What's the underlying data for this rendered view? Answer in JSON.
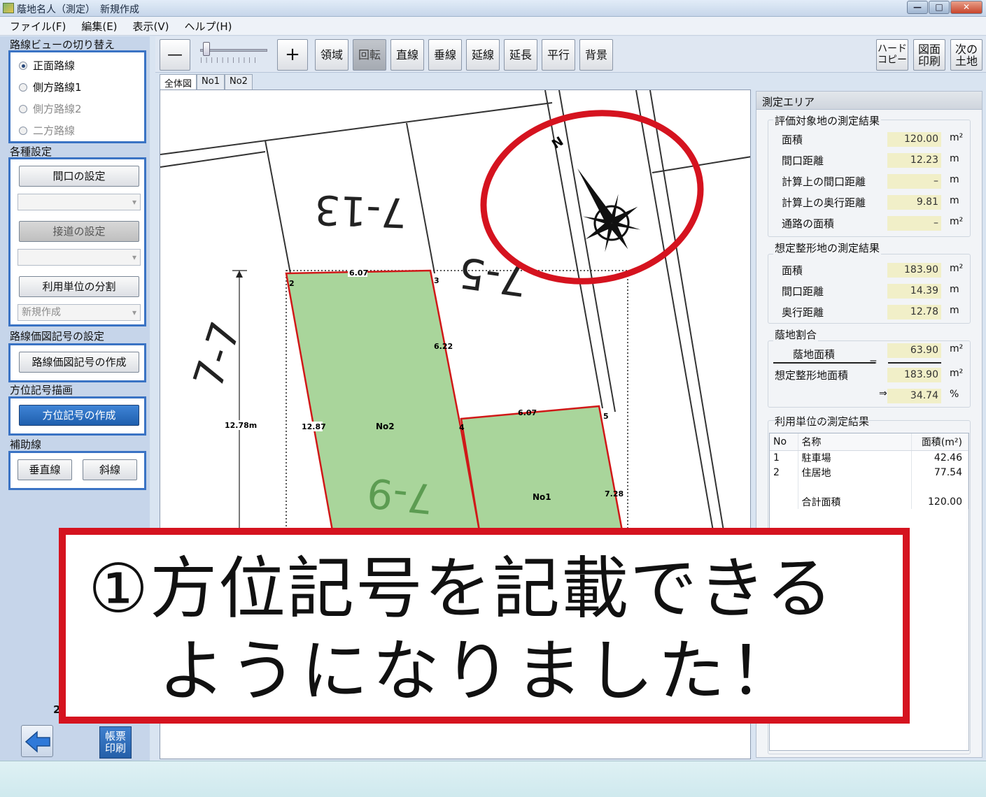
{
  "window": {
    "title": "蔭地名人（測定）　新規作成",
    "minimize": "—",
    "maximize": "□",
    "close": "✕"
  },
  "menu": [
    "ファイル(F)",
    "編集(E)",
    "表示(V)",
    "ヘルプ(H)"
  ],
  "sidebar": {
    "route_view_title": "路線ビューの切り替え",
    "route_options": [
      {
        "label": "正面路線",
        "selected": true,
        "enabled": true
      },
      {
        "label": "側方路線1",
        "selected": false,
        "enabled": true
      },
      {
        "label": "側方路線2",
        "selected": false,
        "enabled": false
      },
      {
        "label": "二方路線",
        "selected": false,
        "enabled": false
      }
    ],
    "settings_title": "各種設定",
    "frontage_button": "間口の設定",
    "road_contact_button": "接道の設定",
    "split_units_button": "利用単位の分割",
    "new_create_combo": "新規作成",
    "route_price_title": "路線価図記号の設定",
    "route_price_button": "路線価図記号の作成",
    "compass_title": "方位記号描画",
    "compass_button": "方位記号の作成",
    "aux_title": "補助線",
    "vertical_button": "垂直線",
    "diagonal_button": "斜線",
    "page_number": "2",
    "print_form_button": "帳票\n印刷"
  },
  "toolbar": {
    "zoom_out": "—",
    "zoom_in": "+",
    "zoom_level": 0.05,
    "buttons": [
      "領域",
      "回転",
      "直線",
      "垂線",
      "延線",
      "延長",
      "平行",
      "背景"
    ],
    "pressed": "回転",
    "hard_copy": "ハード\nコピー",
    "print_drawing": "図面\n印刷",
    "next_land": "次の\n土地"
  },
  "tabs": [
    "全体図",
    "No1",
    "No2"
  ],
  "drawing": {
    "parcel_labels": [
      "7-13",
      "7-5",
      "7-9",
      "7-7"
    ],
    "compass_letter": "N",
    "point_numbers": [
      "2",
      "3",
      "4",
      "5"
    ],
    "dimension_labels": [
      "6.07",
      "6.22",
      "6.07",
      "12.87",
      "7.28",
      "12.78m"
    ],
    "area_labels": [
      "No2",
      "No1"
    ]
  },
  "right_panel": {
    "title": "測定エリア",
    "eval_group_title": "評価対象地の測定結果",
    "eval_rows": [
      {
        "label": "面積",
        "value": "120.00",
        "unit": "m²"
      },
      {
        "label": "間口距離",
        "value": "12.23",
        "unit": "m"
      },
      {
        "label": "計算上の間口距離",
        "value": "–",
        "unit": "m"
      },
      {
        "label": "計算上の奥行距離",
        "value": "9.81",
        "unit": "m"
      },
      {
        "label": "通路の面積",
        "value": "–",
        "unit": "m²"
      }
    ],
    "assumed_group_title": "想定整形地の測定結果",
    "assumed_rows": [
      {
        "label": "面積",
        "value": "183.90",
        "unit": "m²"
      },
      {
        "label": "間口距離",
        "value": "14.39",
        "unit": "m"
      },
      {
        "label": "奥行距離",
        "value": "12.78",
        "unit": "m"
      }
    ],
    "ratio_group_title": "蔭地割合",
    "ratio_numerator_label": "蔭地面積",
    "ratio_numerator_value": "63.90",
    "ratio_denominator_label": "想定整形地面積",
    "ratio_denominator_value": "183.90",
    "ratio_result_value": "34.74",
    "ratio_eq": "=",
    "ratio_arrow": "⇒",
    "unit_m2": "m²",
    "unit_pct": "%",
    "units_group_title": "利用単位の測定結果",
    "table_headers": [
      "No",
      "名称",
      "面積(m²)"
    ],
    "table_rows": [
      {
        "no": "1",
        "name": "駐車場",
        "area": "42.46"
      },
      {
        "no": "2",
        "name": "住居地",
        "area": "77.54"
      }
    ],
    "total_label": "合計面積",
    "total_value": "120.00"
  },
  "callout": {
    "line1": "①方位記号を記載できる",
    "line2": "ようになりました！"
  }
}
